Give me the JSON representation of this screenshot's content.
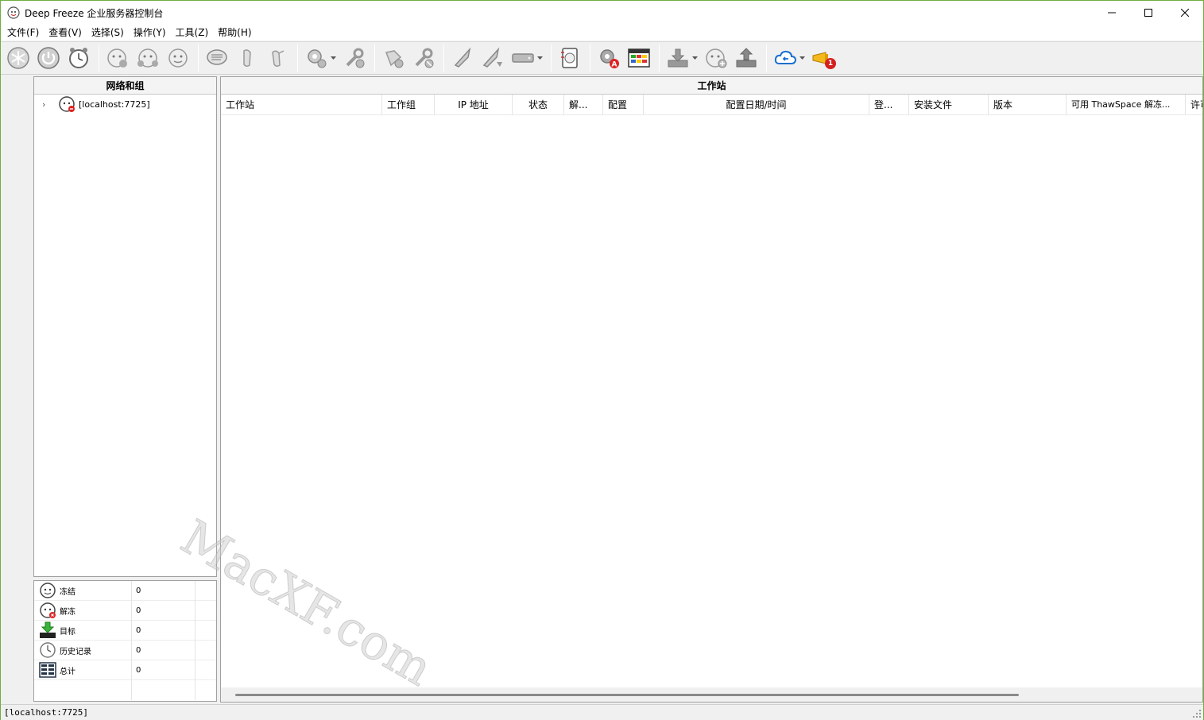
{
  "window": {
    "title": "Deep Freeze 企业服务器控制台"
  },
  "menu": [
    "文件(F)",
    "查看(V)",
    "选择(S)",
    "操作(Y)",
    "工具(Z)",
    "帮助(H)"
  ],
  "toolbar": {
    "icons": [
      "freeze-icon",
      "power-icon",
      "clock-icon",
      "freeze-next-icon",
      "thaw-icon",
      "thaw-locked-icon",
      "message-icon",
      "lock-icon",
      "unlock-icon",
      "settings-icon",
      "update-icon",
      "install-icon",
      "uninstall-icon",
      "rocket-icon",
      "rocket-remote-icon",
      "drive-icon",
      "log-icon",
      "gear-alert-icon",
      "scheduler-icon",
      "download-icon",
      "add-workstation-icon",
      "upload-icon",
      "cloud-icon",
      "alert-icon"
    ],
    "alert_badge": "1"
  },
  "tree_panel": {
    "header": "网络和组",
    "nodes": [
      {
        "label": "[localhost:7725]"
      }
    ]
  },
  "stats": [
    {
      "label": "冻结",
      "value": "0",
      "icon": "frozen-icon"
    },
    {
      "label": "解冻",
      "value": "0",
      "icon": "thawed-icon"
    },
    {
      "label": "目标",
      "value": "0",
      "icon": "target-icon"
    },
    {
      "label": "历史记录",
      "value": "0",
      "icon": "history-icon"
    },
    {
      "label": "总计",
      "value": "0",
      "icon": "total-icon"
    }
  ],
  "workstation_panel": {
    "header": "工作站",
    "columns": [
      "工作站",
      "工作组",
      "IP 地址",
      "状态",
      "解...",
      "配置",
      "配置日期/时间",
      "登...",
      "安装文件",
      "版本",
      "可用 ThawSpace 解冻...",
      "许可"
    ]
  },
  "statusbar": {
    "text": "[localhost:7725]"
  },
  "watermark": {
    "text": "MacXF.com"
  }
}
